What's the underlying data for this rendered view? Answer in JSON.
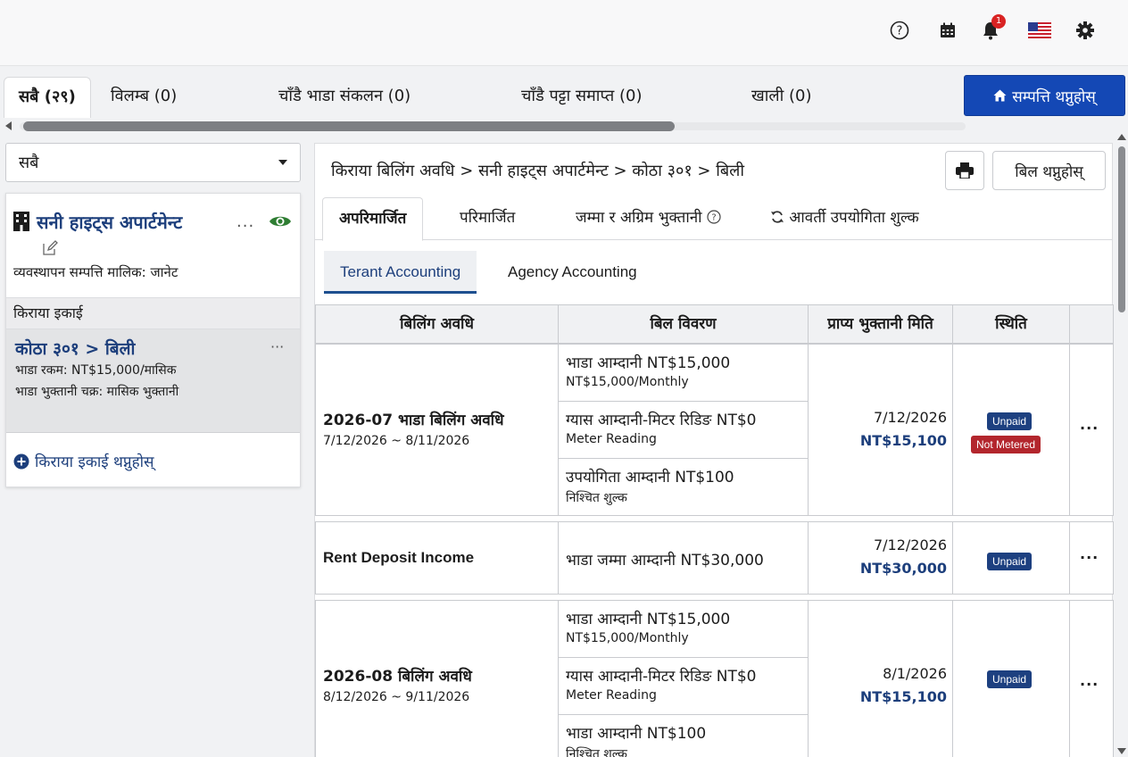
{
  "header": {
    "notification_count": "1",
    "icons": [
      "help-icon",
      "calendar-icon",
      "bell-icon",
      "us-flag-icon",
      "gear-icon"
    ]
  },
  "status_tabs": [
    {
      "label": "सबै (२९)",
      "active": true
    },
    {
      "label": "विलम्ब (0)"
    },
    {
      "label": "चाँडै भाडा संकलन (0)"
    },
    {
      "label": "चाँडै पट्टा समाप्त (0)"
    },
    {
      "label": "खाली (0)"
    }
  ],
  "add_property_label": "सम्पत्ति थप्नुहोस्",
  "filter": {
    "selected": "सबै"
  },
  "property": {
    "name": "सनी हाइट्स अपार्टमेन्ट",
    "owner": "व्यवस्थापन सम्पत्ति मालिक: जानेट",
    "more": "···",
    "unit_header": "किराया इकाई",
    "unit": {
      "title": "कोठा ३०१ > बिली",
      "more": "···",
      "rent": "भाडा रकम: NT$15,000/मासिक",
      "cycle": "भाडा भुक्तानी चक्र: मासिक भुक्तानी"
    },
    "add_unit_label": "किराया इकाई थप्नुहोस्"
  },
  "main": {
    "breadcrumb": "किराया बिलिंग अवधि > सनी हाइट्स अपार्टमेन्ट > कोठा ३०१ > बिली",
    "add_bill_label": "बिल थप्नुहोस्",
    "bill_tabs": [
      "अपरिमार्जित",
      "परिमार्जित",
      "जम्मा र अग्रिम भुक्तानी",
      "आवर्ती उपयोगिता शुल्क"
    ],
    "accounting_tabs": [
      "Terant Accounting",
      "Agency Accounting"
    ],
    "table": {
      "headers": [
        "बिलिंग अवधि",
        "बिल विवरण",
        "प्राप्य भुक्तानी मिति",
        "स्थिति"
      ],
      "groups": [
        {
          "period_title": "2026-07 भाडा बिलिंग अवधि",
          "period_range": "7/12/2026 ~ 8/11/2026",
          "items": [
            {
              "main": "भाडा आम्दानी NT$15,000",
              "sub": "NT$15,000/Monthly"
            },
            {
              "main": "ग्यास आम्दानी-मिटर रिडिङ NT$0",
              "sub": "Meter Reading"
            },
            {
              "main": "उपयोगिता आम्दानी NT$100",
              "sub": "निश्चित शुल्क"
            }
          ],
          "due_date": "7/12/2026",
          "due_amount": "NT$15,100",
          "statuses": [
            "Unpaid",
            "Not Metered"
          ],
          "more": "···"
        },
        {
          "period_title": "Rent Deposit Income",
          "period_range": "",
          "items": [
            {
              "main": "भाडा जम्मा आम्दानी NT$30,000",
              "sub": ""
            }
          ],
          "due_date": "7/12/2026",
          "due_amount": "NT$30,000",
          "statuses": [
            "Unpaid"
          ],
          "more": "···"
        },
        {
          "period_title": "2026-08 बिलिंग अवधि",
          "period_range": "8/12/2026 ~ 9/11/2026",
          "items": [
            {
              "main": "भाडा आम्दानी NT$15,000",
              "sub": "NT$15,000/Monthly"
            },
            {
              "main": "ग्यास आम्दानी-मिटर रिडिङ NT$0",
              "sub": "Meter Reading"
            },
            {
              "main": "भाडा आम्दानी NT$100",
              "sub": "निश्चित शुल्क"
            }
          ],
          "due_date": "8/1/2026",
          "due_amount": "NT$15,100",
          "statuses": [
            "Unpaid"
          ],
          "more": "···"
        }
      ]
    }
  },
  "colors": {
    "primary": "#1448b5",
    "link": "#1d3f7c",
    "unpaid": "#1d4080",
    "not_metered": "#b3262d",
    "eye": "#2e7d32"
  }
}
